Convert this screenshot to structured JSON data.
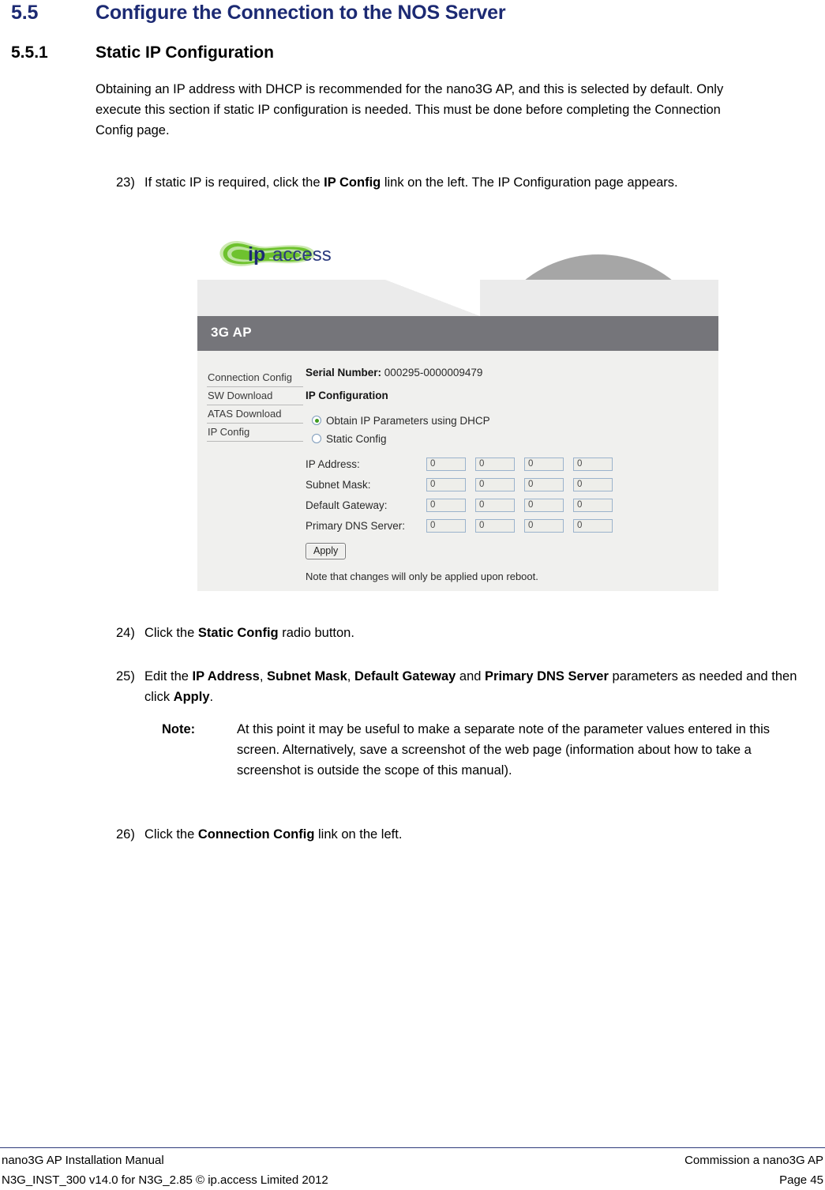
{
  "headings": {
    "section_number": "5.5",
    "section_title": "Configure the Connection to the NOS Server",
    "subsection_number": "5.5.1",
    "subsection_title": "Static IP Configuration",
    "heading_color": "#1c2a73"
  },
  "intro_paragraph": "Obtaining an IP address with DHCP is recommended for the nano3G AP, and this is selected by default. Only execute this section if static IP configuration is needed. This must be done before completing the Connection Config page.",
  "steps": {
    "step23": {
      "number": "23)",
      "part1": "If static IP is required, click the ",
      "bold1": "IP Config",
      "part2": " link on the left. The IP Configuration page appears."
    },
    "step24": {
      "number": "24)",
      "part1": "Click the ",
      "bold1": "Static Config",
      "part2": " radio button."
    },
    "step25": {
      "number": "25)",
      "part1": "Edit the ",
      "bold1": "IP Address",
      "part2": ", ",
      "bold2": "Subnet Mask",
      "part3": ", ",
      "bold3": "Default Gateway",
      "part4": " and ",
      "bold4": "Primary DNS Server",
      "part5": " parameters as needed and then click ",
      "bold5": "Apply",
      "part6": "."
    },
    "step26": {
      "number": "26)",
      "part1": "Click the ",
      "bold1": "Connection Config",
      "part2": " link on the left."
    }
  },
  "note": {
    "label": "Note:",
    "text": "At this point it may be useful to make a separate note of the parameter values entered in this screen. Alternatively, save a screenshot of the web page (information about how to take a screenshot is outside the scope of this manual)."
  },
  "screenshot": {
    "logo": {
      "word_bold": "ip",
      "word_rest": "access",
      "blob_color": "#66bb33",
      "text_color": "#1c2a73"
    },
    "titlebar": "3G AP",
    "nav_items": [
      "Connection Config",
      "SW Download",
      "ATAS Download",
      "IP Config"
    ],
    "serial": {
      "label": "Serial Number:",
      "value": "000295-0000009479"
    },
    "section_title": "IP Configuration",
    "radios": [
      {
        "label": "Obtain IP Parameters using DHCP",
        "selected": true
      },
      {
        "label": "Static Config",
        "selected": false
      }
    ],
    "fields": [
      {
        "label": "IP Address:",
        "octets": [
          "0",
          "0",
          "0",
          "0"
        ]
      },
      {
        "label": "Subnet Mask:",
        "octets": [
          "0",
          "0",
          "0",
          "0"
        ]
      },
      {
        "label": "Default Gateway:",
        "octets": [
          "0",
          "0",
          "0",
          "0"
        ]
      },
      {
        "label": "Primary DNS Server:",
        "octets": [
          "0",
          "0",
          "0",
          "0"
        ]
      }
    ],
    "apply_button": "Apply",
    "reboot_note": "Note that changes will only be applied upon reboot.",
    "colors": {
      "titlebar_bg": "#75757a",
      "body_bg": "#f0f0ee",
      "input_border": "#9bb3cc",
      "radio_dot": "#3f9b1f"
    }
  },
  "footer": {
    "left_line1": "nano3G AP Installation Manual",
    "left_line2": "N3G_INST_300 v14.0 for N3G_2.85 © ip.access Limited 2012",
    "right_line1": "Commission a nano3G AP",
    "right_line2": "Page 45"
  }
}
